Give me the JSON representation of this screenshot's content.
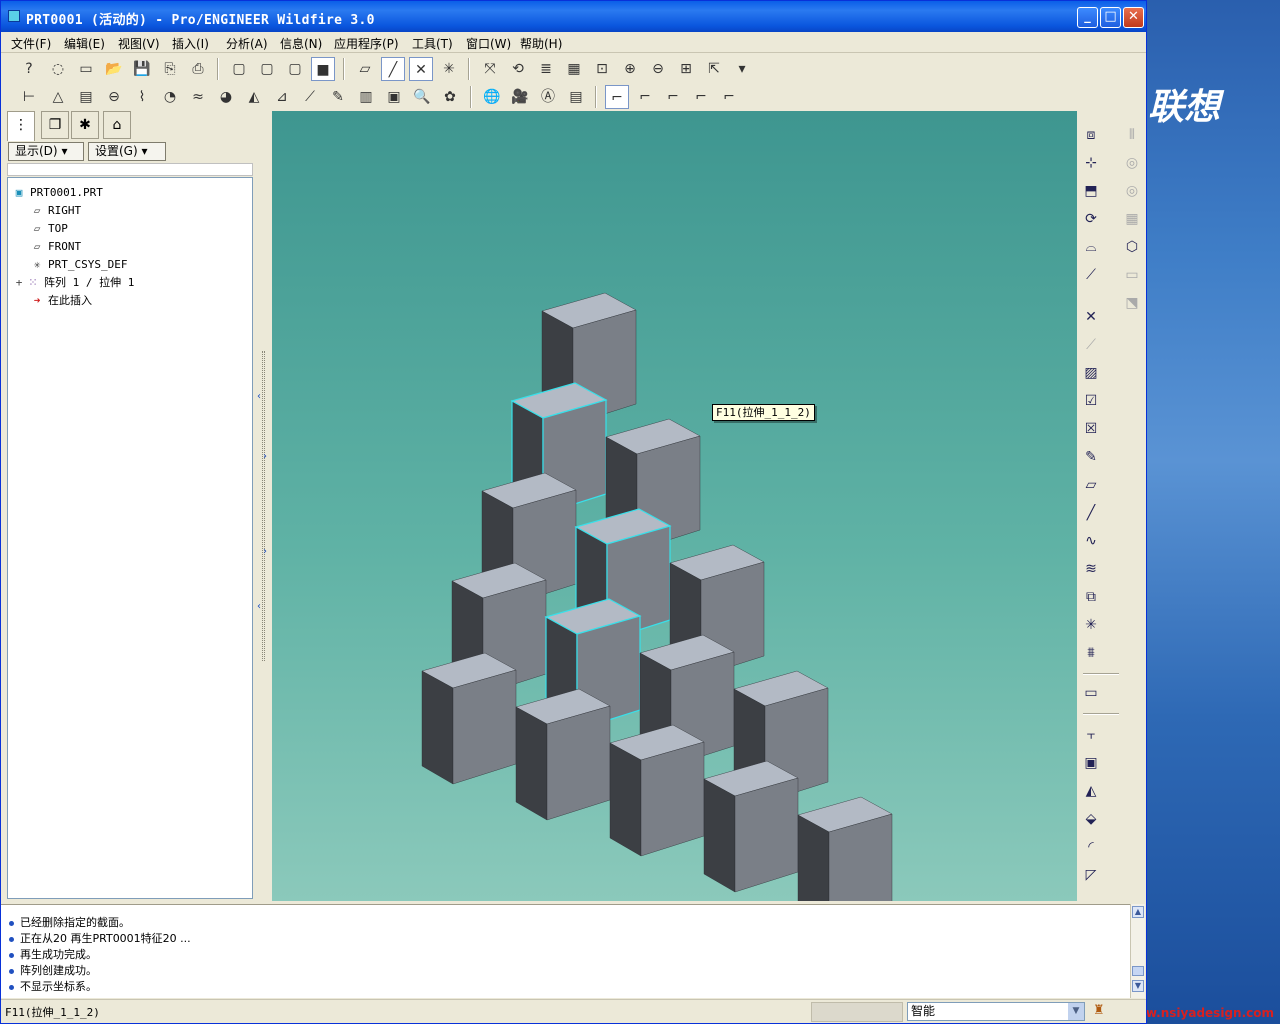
{
  "desktop": {
    "brand_text": "联想",
    "watermark": "www.nsiyadesign.com"
  },
  "window": {
    "title": "PRT0001 (活动的) - Pro/ENGINEER Wildfire 3.0",
    "minimize": "_",
    "maximize": "□",
    "close": "✕"
  },
  "menu": [
    "文件(F)",
    "编辑(E)",
    "视图(V)",
    "插入(I)",
    "分析(A)",
    "信息(N)",
    "应用程序(P)",
    "工具(T)",
    "窗口(W)",
    "帮助(H)"
  ],
  "navigator": {
    "show_button": "显示(D)",
    "settings_button": "设置(G)",
    "tree": [
      {
        "label": "PRT0001.PRT",
        "icon": "part-icon"
      },
      {
        "label": "RIGHT",
        "icon": "datum-plane-icon"
      },
      {
        "label": "TOP",
        "icon": "datum-plane-icon"
      },
      {
        "label": "FRONT",
        "icon": "datum-plane-icon"
      },
      {
        "label": "PRT_CSYS_DEF",
        "icon": "csys-icon"
      },
      {
        "label": "阵列 1 / 拉伸 1",
        "icon": "pattern-icon",
        "expander": "+"
      },
      {
        "label": "在此插入",
        "icon": "insert-arrow-icon"
      }
    ]
  },
  "viewport": {
    "tooltip": "F11(拉伸_1_1_2)",
    "model": "stepped cube pattern, 15 cubes in 5 rows",
    "background_top": "#3e9690",
    "background_bottom": "#8bc9bb"
  },
  "messages": [
    "已经删除指定的截面。",
    "正在从20 再生PRT0001特征20 ...",
    "再生成功完成。",
    "阵列创建成功。",
    "不显示坐标系。"
  ],
  "status": {
    "text": "F11(拉伸_1_1_2)",
    "filter": "智能"
  }
}
